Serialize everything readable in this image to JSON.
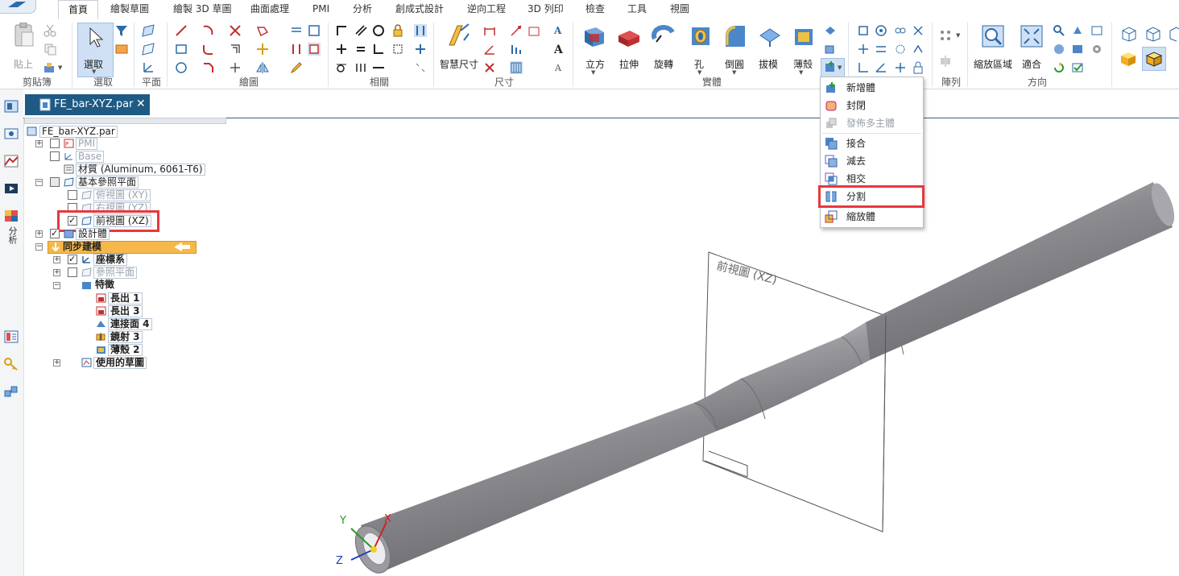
{
  "ribbon": {
    "tabs": [
      "首頁",
      "繪製草圖",
      "繪製 3D 草圖",
      "曲面處理",
      "PMI",
      "分析",
      "創成式設計",
      "逆向工程",
      "3D 列印",
      "檢查",
      "工具",
      "視圖"
    ],
    "active_tab": "首頁",
    "groups": {
      "clipboard": {
        "label": "剪貼簿",
        "paste": "貼上"
      },
      "select": {
        "label": "選取",
        "select": "選取"
      },
      "plane": {
        "label": "平面"
      },
      "draw": {
        "label": "繪圖"
      },
      "relate": {
        "label": "相關"
      },
      "dimension": {
        "label": "尺寸",
        "smart_dim": "智慧尺寸"
      },
      "solids": {
        "label": "實體",
        "extrude": "拉伸",
        "revolve": "旋轉",
        "hole": "孔",
        "round": "倒圓",
        "draft": "拔模",
        "thin_wall": "薄殼",
        "cube": "立方"
      },
      "pattern": {
        "label": "陣列"
      },
      "orient": {
        "label": "方向",
        "zoom_area": "縮放區域",
        "fit": "適合"
      }
    }
  },
  "document": {
    "tab_title": "FE_bar-XYZ.par",
    "close": "✕"
  },
  "left_strip": {
    "analysis_label": "分析"
  },
  "tree": {
    "root": "FE_bar-XYZ.par",
    "pmi": "PMI",
    "base": "Base",
    "material": "材質 (Aluminum, 6061-T6)",
    "base_ref_planes": "基本參照平面",
    "top_view": "俯視圖 (XY)",
    "right_view": "右視圖 (YZ)",
    "front_view": "前視圖 (XZ)",
    "design_body": "設計體",
    "sync_model": "同步建模",
    "coord_sys": "座標系",
    "ref_planes": "參照平面",
    "features": "特徵",
    "feat_items": [
      "長出 1",
      "長出 3",
      "連接面 4",
      "鏡射 3",
      "薄殼 2"
    ],
    "used_sketches": "使用的草圖"
  },
  "dropdown": {
    "items": [
      {
        "label": "新增體",
        "enabled": true
      },
      {
        "label": "封閉",
        "enabled": true
      },
      {
        "label": "發佈多主體",
        "enabled": false
      },
      {
        "label": "接合",
        "enabled": true
      },
      {
        "label": "減去",
        "enabled": true
      },
      {
        "label": "相交",
        "enabled": true
      },
      {
        "label": "分割",
        "enabled": true,
        "highlighted": true
      },
      {
        "label": "縮放體",
        "enabled": true
      }
    ]
  },
  "viewport": {
    "plane_label": "前視圖 (XZ)",
    "axes": {
      "x": "X",
      "y": "Y",
      "z": "Z"
    }
  },
  "colors": {
    "highlight_red": "#e8383d",
    "tab_blue": "#1e5a84",
    "sync_orange": "#f6b84a"
  }
}
